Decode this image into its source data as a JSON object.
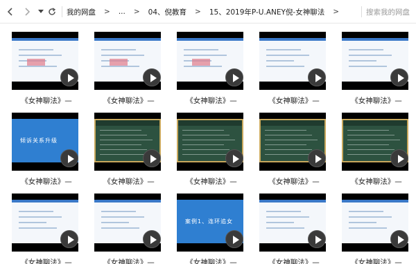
{
  "toolbar": {
    "breadcrumbs": [
      "我的网盘",
      "...",
      "04、倪教育",
      "15、2019年P-U.ANEY倪-女神聊法"
    ],
    "search_placeholder": "搜索我的网盘"
  },
  "files": [
    {
      "label": "《女神聊法》—",
      "style": "white"
    },
    {
      "label": "《女神聊法》—",
      "style": "white"
    },
    {
      "label": "《女神聊法》—",
      "style": "white"
    },
    {
      "label": "《女神聊法》—",
      "style": "white"
    },
    {
      "label": "《女神聊法》—",
      "style": "white"
    },
    {
      "label": "《女神聊法》—",
      "style": "blue",
      "slide_text": "倾诉关系升级"
    },
    {
      "label": "《女神聊法》—",
      "style": "green"
    },
    {
      "label": "《女神聊法》—",
      "style": "green"
    },
    {
      "label": "《女神聊法》—",
      "style": "green"
    },
    {
      "label": "《女神聊法》—",
      "style": "green"
    },
    {
      "label": "《女神聊法》—",
      "style": "white"
    },
    {
      "label": "《女神聊法》—",
      "style": "white"
    },
    {
      "label": "《女神聊法》—",
      "style": "blue",
      "slide_text": "案例1、连环追女"
    },
    {
      "label": "《女神聊法》—",
      "style": "white"
    },
    {
      "label": "《女神聊法》—",
      "style": "white"
    }
  ]
}
